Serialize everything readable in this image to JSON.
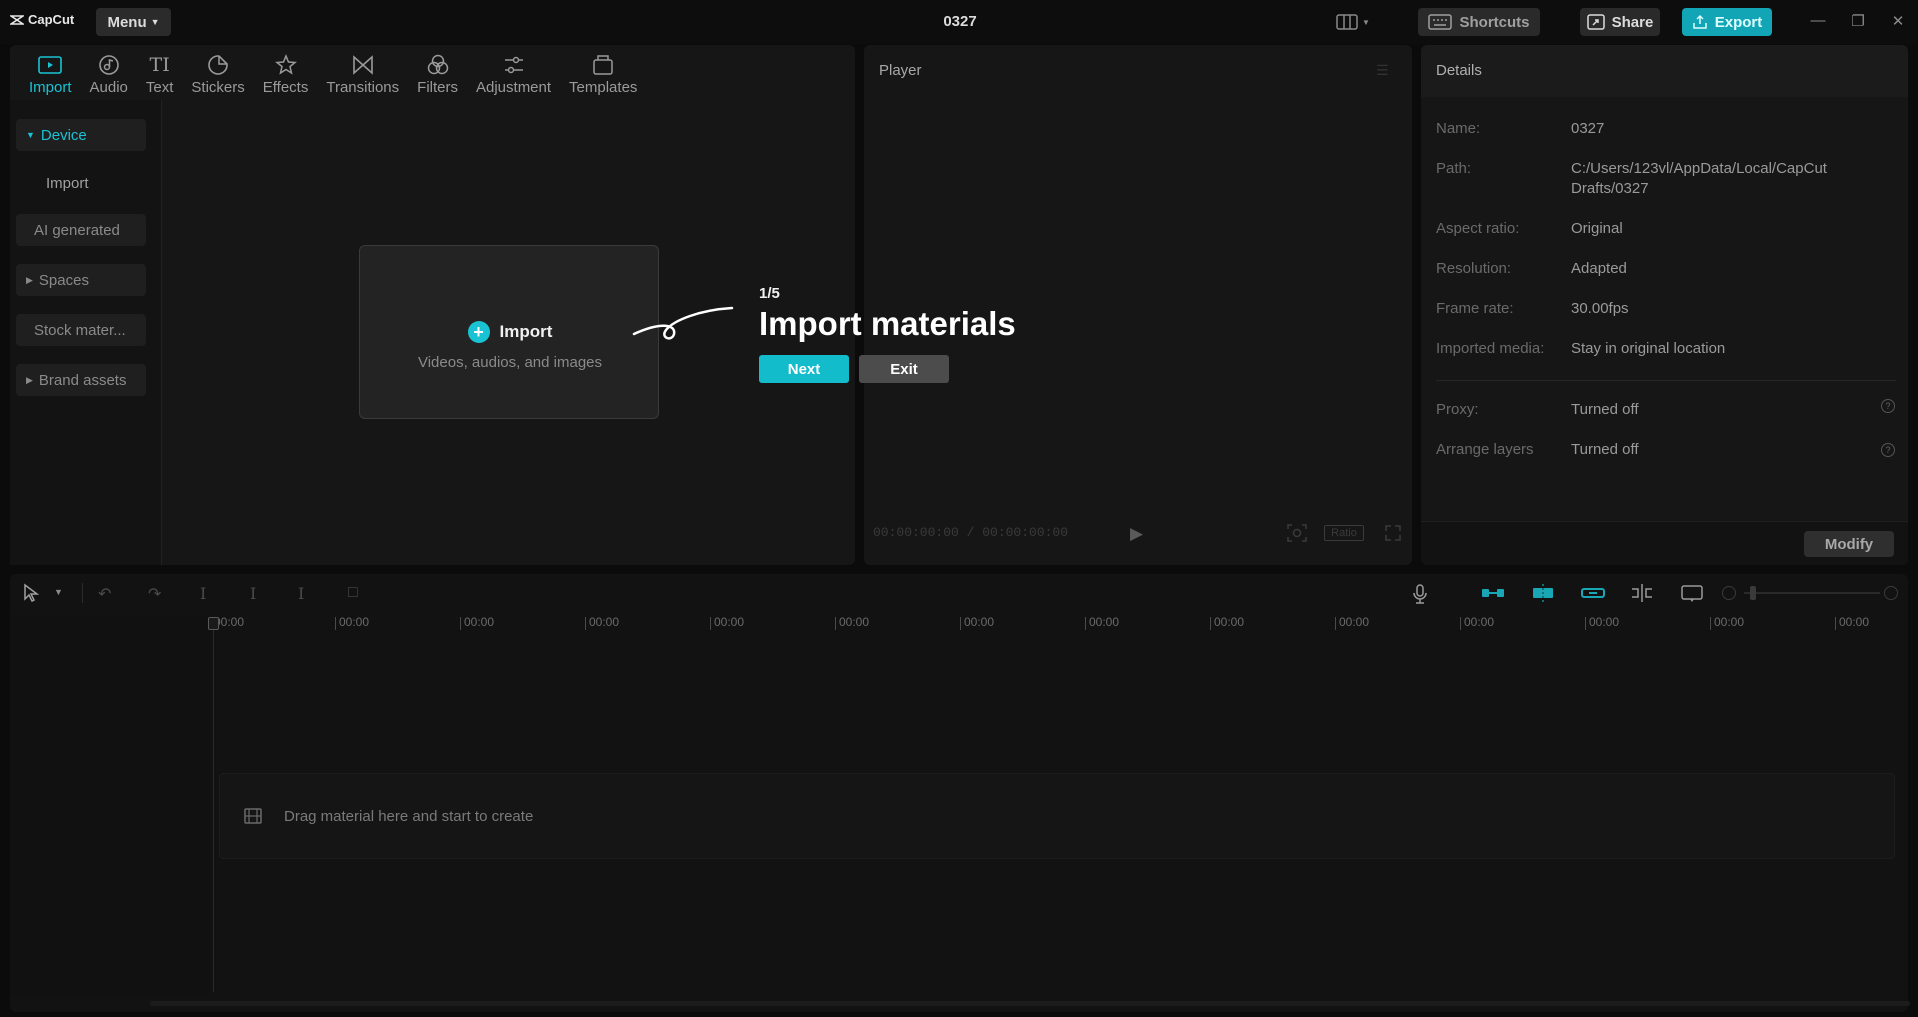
{
  "app": {
    "logo_text": "CapCut",
    "menu_label": "Menu",
    "project_title": "0327"
  },
  "header": {
    "shortcuts_label": "Shortcuts",
    "share_label": "Share",
    "export_label": "Export"
  },
  "tools": [
    {
      "label": "Import",
      "icon": "import-icon"
    },
    {
      "label": "Audio",
      "icon": "audio-icon"
    },
    {
      "label": "Text",
      "icon": "text-icon"
    },
    {
      "label": "Stickers",
      "icon": "stickers-icon"
    },
    {
      "label": "Effects",
      "icon": "effects-icon"
    },
    {
      "label": "Transitions",
      "icon": "transitions-icon"
    },
    {
      "label": "Filters",
      "icon": "filters-icon"
    },
    {
      "label": "Adjustment",
      "icon": "adjustment-icon"
    },
    {
      "label": "Templates",
      "icon": "templates-icon"
    }
  ],
  "sidebar": {
    "items": [
      {
        "label": "Device"
      },
      {
        "label": "Import"
      },
      {
        "label": "AI generated"
      },
      {
        "label": "Spaces"
      },
      {
        "label": "Stock mater..."
      },
      {
        "label": "Brand assets"
      }
    ]
  },
  "import_box": {
    "label": "Import",
    "subtitle": "Videos, audios, and images"
  },
  "onboarding": {
    "step": "1/5",
    "title": "Import materials",
    "next_label": "Next",
    "exit_label": "Exit"
  },
  "player": {
    "title": "Player",
    "timecode": "00:00:00:00 / 00:00:00:00",
    "ratio_label": "Ratio"
  },
  "details": {
    "title": "Details",
    "rows": [
      {
        "label": "Name:",
        "value": "0327"
      },
      {
        "label": "Path:",
        "value": "C:/Users/123vl/AppData/Local/CapCut Drafts/0327"
      },
      {
        "label": "Aspect ratio:",
        "value": "Original"
      },
      {
        "label": "Resolution:",
        "value": "Adapted"
      },
      {
        "label": "Frame rate:",
        "value": "30.00fps"
      },
      {
        "label": "Imported media:",
        "value": "Stay in original location"
      },
      {
        "label": "Proxy:",
        "value": "Turned off"
      },
      {
        "label": "Arrange layers",
        "value": "Turned off"
      }
    ],
    "modify_label": "Modify"
  },
  "timeline": {
    "ticks": [
      "00:00",
      "00:00",
      "00:00",
      "00:00",
      "00:00",
      "00:00",
      "00:00",
      "00:00",
      "00:00",
      "00:00",
      "00:00",
      "00:00",
      "00:00",
      "00:00"
    ],
    "drop_hint": "Drag material here and start to create"
  },
  "colors": {
    "accent": "#19c3d3",
    "export": "#12a5b5",
    "background": "#0b0b0b"
  }
}
